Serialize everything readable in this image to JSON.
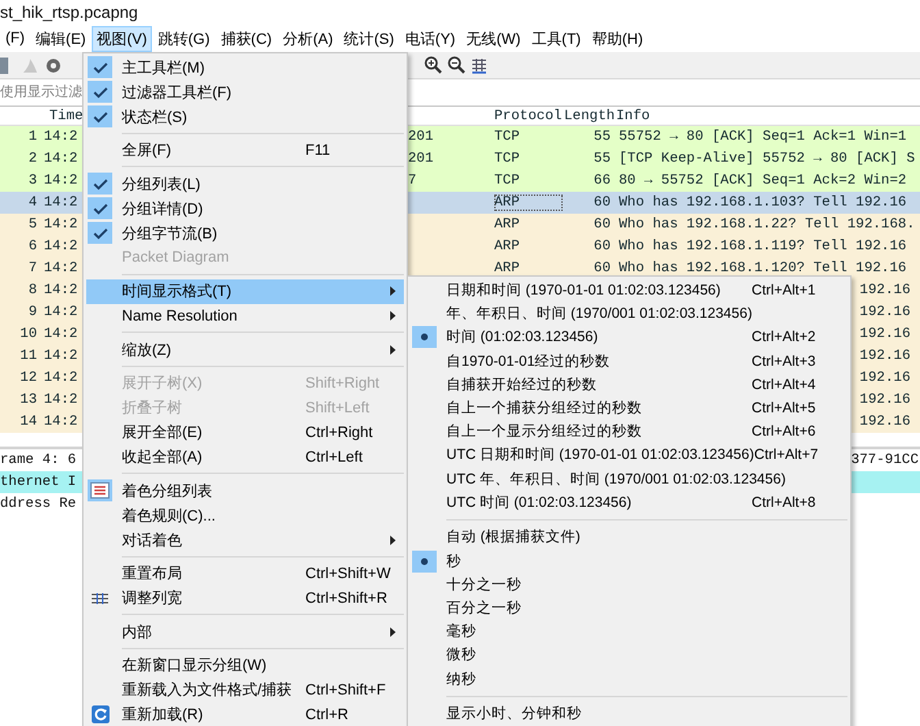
{
  "title": "st_hik_rtsp.pcapng",
  "menubar": [
    {
      "label": "(F)",
      "selected": false
    },
    {
      "label": "编辑(E)",
      "selected": false
    },
    {
      "label": "视图(V)",
      "selected": true
    },
    {
      "label": "跳转(G)",
      "selected": false
    },
    {
      "label": "捕获(C)",
      "selected": false
    },
    {
      "label": "分析(A)",
      "selected": false
    },
    {
      "label": "统计(S)",
      "selected": false
    },
    {
      "label": "电话(Y)",
      "selected": false
    },
    {
      "label": "无线(W)",
      "selected": false
    },
    {
      "label": "工具(T)",
      "selected": false
    },
    {
      "label": "帮助(H)",
      "selected": false
    }
  ],
  "filter": {
    "placeholder": "使用显示过滤"
  },
  "packet_list": {
    "columns": [
      {
        "label": "Time"
      },
      {
        "label": "Protocol"
      },
      {
        "label": "Length"
      },
      {
        "label": "Info"
      }
    ],
    "rows": [
      {
        "number": "1",
        "time": "14:2",
        "column_3": "201",
        "protocol": "TCP",
        "length": "55",
        "info": "55752 → 80 [ACK] Seq=1 Ack=1 Win=1",
        "color": "#e4ffc7",
        "selected": false
      },
      {
        "number": "2",
        "time": "14:2",
        "column_3": "201",
        "protocol": "TCP",
        "length": "55",
        "info": "[TCP Keep-Alive] 55752 → 80 [ACK] S",
        "color": "#e4ffc7",
        "selected": false
      },
      {
        "number": "3",
        "time": "14:2",
        "column_3": "7",
        "protocol": "TCP",
        "length": "66",
        "info": "80 → 55752 [ACK] Seq=1 Ack=2 Win=2",
        "color": "#e4ffc7",
        "selected": false
      },
      {
        "number": "4",
        "time": "14:2",
        "protocol": "ARP",
        "length": "60",
        "info": "Who has 192.168.1.103? Tell 192.16",
        "selected": true
      },
      {
        "number": "5",
        "time": "14:2",
        "protocol": "ARP",
        "length": "60",
        "info": "Who has 192.168.1.22? Tell 192.168.",
        "color": "#faf0d7",
        "selected": false
      },
      {
        "number": "6",
        "time": "14:2",
        "protocol": "ARP",
        "length": "60",
        "info": "Who has 192.168.1.119? Tell 192.16",
        "color": "#faf0d7",
        "selected": false
      },
      {
        "number": "7",
        "time": "14:2",
        "protocol": "ARP",
        "length": "60",
        "info": "Who has 192.168.1.120? Tell 192.16",
        "color": "#faf0d7",
        "selected": false
      },
      {
        "number": "8",
        "time": "14:2",
        "info_end": "192.16",
        "color": "#faf0d7",
        "selected": false
      },
      {
        "number": "9",
        "time": "14:2",
        "info_end": "192.16",
        "color": "#faf0d7",
        "selected": false
      },
      {
        "number": "10",
        "time": "14:2",
        "info_end": "192.16",
        "color": "#faf0d7",
        "selected": false
      },
      {
        "number": "11",
        "time": "14:2",
        "info_end": "192.16",
        "color": "#faf0d7",
        "selected": false
      },
      {
        "number": "12",
        "time": "14:2",
        "info_end": "192.16",
        "color": "#faf0d7",
        "selected": false
      },
      {
        "number": "13",
        "time": "14:2",
        "info_end": "192.16",
        "color": "#faf0d7",
        "selected": false
      },
      {
        "number": "14",
        "time": "14:2",
        "info_end": "192.16",
        "color": "#faf0d7",
        "selected": false
      }
    ]
  },
  "details": [
    {
      "text": "rame 4: 6",
      "text_end": "377-91CC",
      "selected": false
    },
    {
      "text": "thernet I",
      "selected": true
    },
    {
      "text": "ddress Re",
      "selected": false
    }
  ],
  "view_menu": [
    {
      "kind": "item",
      "label": "主工具栏(M)",
      "checked": true,
      "disabled": false,
      "selected": false,
      "submenu": false
    },
    {
      "kind": "item",
      "label": "过滤器工具栏(F)",
      "checked": true,
      "disabled": false,
      "selected": false,
      "submenu": false
    },
    {
      "kind": "item",
      "label": "状态栏(S)",
      "checked": true,
      "disabled": false,
      "selected": false,
      "submenu": false
    },
    {
      "kind": "separator"
    },
    {
      "kind": "item",
      "label": "全屏(F)",
      "shortcut": "F11",
      "checked": false,
      "disabled": false,
      "selected": false,
      "submenu": false
    },
    {
      "kind": "separator"
    },
    {
      "kind": "item",
      "label": "分组列表(L)",
      "checked": true,
      "disabled": false,
      "selected": false,
      "submenu": false
    },
    {
      "kind": "item",
      "label": "分组详情(D)",
      "checked": true,
      "disabled": false,
      "selected": false,
      "submenu": false
    },
    {
      "kind": "item",
      "label": "分组字节流(B)",
      "checked": true,
      "disabled": false,
      "selected": false,
      "submenu": false
    },
    {
      "kind": "item",
      "label": "Packet Diagram",
      "checked": false,
      "disabled": true,
      "selected": false,
      "submenu": false
    },
    {
      "kind": "separator"
    },
    {
      "kind": "item",
      "label": "时间显示格式(T)",
      "checked": false,
      "disabled": false,
      "selected": true,
      "submenu": true
    },
    {
      "kind": "item",
      "label": "Name Resolution",
      "checked": false,
      "disabled": false,
      "selected": false,
      "submenu": true
    },
    {
      "kind": "separator"
    },
    {
      "kind": "item",
      "label": "缩放(Z)",
      "checked": false,
      "disabled": false,
      "selected": false,
      "submenu": true
    },
    {
      "kind": "separator"
    },
    {
      "kind": "item",
      "label": "展开子树(X)",
      "shortcut": "Shift+Right",
      "checked": false,
      "disabled": true,
      "selected": false,
      "submenu": false
    },
    {
      "kind": "item",
      "label": "折叠子树",
      "shortcut": "Shift+Left",
      "checked": false,
      "disabled": true,
      "selected": false,
      "submenu": false
    },
    {
      "kind": "item",
      "label": "展开全部(E)",
      "shortcut": "Ctrl+Right",
      "checked": false,
      "disabled": false,
      "selected": false,
      "submenu": false
    },
    {
      "kind": "item",
      "label": "收起全部(A)",
      "shortcut": "Ctrl+Left",
      "checked": false,
      "disabled": false,
      "selected": false,
      "submenu": false
    },
    {
      "kind": "separator"
    },
    {
      "kind": "icon",
      "label": "着色分组列表",
      "checked": true,
      "disabled": false,
      "selected": false,
      "submenu": false
    },
    {
      "kind": "item",
      "label": "着色规则(C)...",
      "checked": false,
      "disabled": false,
      "selected": false,
      "submenu": false
    },
    {
      "kind": "item",
      "label": "对话着色",
      "checked": false,
      "disabled": false,
      "selected": false,
      "submenu": true
    },
    {
      "kind": "separator"
    },
    {
      "kind": "item",
      "label": "重置布局",
      "shortcut": "Ctrl+Shift+W",
      "checked": false,
      "disabled": false,
      "selected": false,
      "submenu": false
    },
    {
      "kind": "icon",
      "label": "调整列宽",
      "shortcut": "Ctrl+Shift+R",
      "checked": false,
      "disabled": false,
      "selected": false,
      "submenu": false
    },
    {
      "kind": "separator"
    },
    {
      "kind": "item",
      "label": "内部",
      "checked": false,
      "disabled": false,
      "selected": false,
      "submenu": true
    },
    {
      "kind": "separator"
    },
    {
      "kind": "item",
      "label": "在新窗口显示分组(W)",
      "checked": false,
      "disabled": false,
      "selected": false,
      "submenu": false
    },
    {
      "kind": "item",
      "label": "重新载入为文件格式/捕获",
      "shortcut": "Ctrl+Shift+F",
      "checked": false,
      "disabled": false,
      "selected": false,
      "submenu": false
    },
    {
      "kind": "icon",
      "label": "重新加载(R)",
      "shortcut": "Ctrl+R",
      "checked": false,
      "disabled": false,
      "selected": false,
      "submenu": false
    }
  ],
  "time_menu": [
    {
      "kind": "item",
      "label": "日期和时间 (1970-01-01 01:02:03.123456)",
      "shortcut": "Ctrl+Alt+1",
      "selected": false
    },
    {
      "kind": "item",
      "label": "年、年积日、时间 (1970/001 01:02:03.123456)",
      "selected": false
    },
    {
      "kind": "item",
      "label": "时间 (01:02:03.123456)",
      "shortcut": "Ctrl+Alt+2",
      "selected": true
    },
    {
      "kind": "item",
      "label": "自1970-01-01经过的秒数",
      "shortcut": "Ctrl+Alt+3",
      "selected": false
    },
    {
      "kind": "item",
      "label": "自捕获开始经过的秒数",
      "shortcut": "Ctrl+Alt+4",
      "selected": false
    },
    {
      "kind": "item",
      "label": "自上一个捕获分组经过的秒数",
      "shortcut": "Ctrl+Alt+5",
      "selected": false
    },
    {
      "kind": "item",
      "label": "自上一个显示分组经过的秒数",
      "shortcut": "Ctrl+Alt+6",
      "selected": false
    },
    {
      "kind": "item",
      "label": "UTC 日期和时间 (1970-01-01 01:02:03.123456)",
      "shortcut": "Ctrl+Alt+7",
      "selected": false
    },
    {
      "kind": "item",
      "label": "UTC 年、年积日、时间 (1970/001 01:02:03.123456)",
      "selected": false
    },
    {
      "kind": "item",
      "label": "UTC 时间 (01:02:03.123456)",
      "shortcut": "Ctrl+Alt+8",
      "selected": false
    },
    {
      "kind": "separator"
    },
    {
      "kind": "item",
      "label": "自动 (根据捕获文件)",
      "selected": false
    },
    {
      "kind": "item",
      "label": "秒",
      "selected": true
    },
    {
      "kind": "item",
      "label": "十分之一秒",
      "selected": false
    },
    {
      "kind": "item",
      "label": "百分之一秒",
      "selected": false
    },
    {
      "kind": "item",
      "label": "毫秒",
      "selected": false
    },
    {
      "kind": "item",
      "label": "微秒",
      "selected": false
    },
    {
      "kind": "item",
      "label": "纳秒",
      "selected": false
    },
    {
      "kind": "separator"
    },
    {
      "kind": "item",
      "label": "显示小时、分钟和秒",
      "selected": false
    }
  ]
}
